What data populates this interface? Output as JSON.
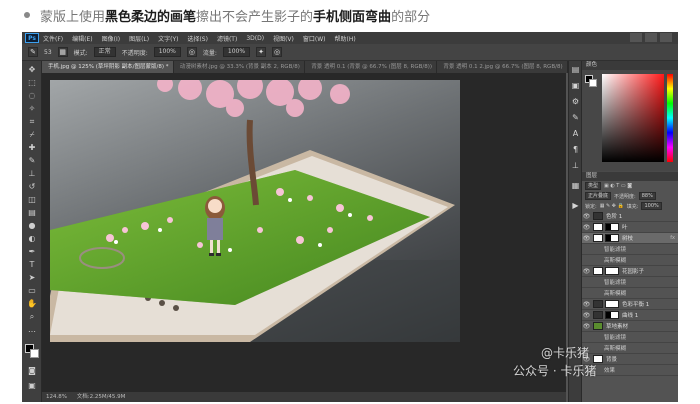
{
  "caption": {
    "part1": "蒙版上使用",
    "part2": "黑色柔边的画笔",
    "part3": "擦出不会产生影子的",
    "part4": "手机侧面弯曲",
    "part5": "的部分"
  },
  "menubar": {
    "logo": "Ps",
    "items": [
      "文件(F)",
      "编辑(E)",
      "图像(I)",
      "图层(L)",
      "文字(Y)",
      "选择(S)",
      "滤镜(T)",
      "3D(D)",
      "视图(V)",
      "窗口(W)",
      "帮助(H)"
    ]
  },
  "options": {
    "brush_size": "53",
    "mode_label": "模式:",
    "mode_value": "正常",
    "opacity_label": "不透明度:",
    "opacity_value": "100%",
    "flow_label": "流量:",
    "flow_value": "100%"
  },
  "tabs": [
    "手机.jpg @ 125% (草坪阴影 副本/图层蒙版/8) *",
    "动漫树素材.jpg @ 33.3% (背景 副本 2, RGB/8)",
    "背景 透明 0.1 (背景 @ 66.7% (图层 8, RGB/8))",
    "背景 透明 0.1 2.jpg @ 66.7% (图层 8, RGB/8)"
  ],
  "status": {
    "zoom": "124.8%",
    "doc": "文档:2.25M/45.9M"
  },
  "color_panel": {
    "title": "颜色",
    "fg": "#000000",
    "bg": "#ffffff"
  },
  "layers": {
    "title": "图层",
    "filter_label": "类型",
    "blend_mode": "正片叠底",
    "opacity_label": "不透明度:",
    "opacity_value": "88%",
    "lock_label": "锁定:",
    "fill_label": "填充:",
    "fill_value": "100%",
    "items": [
      {
        "name": "色阶 1",
        "type": "adjust"
      },
      {
        "name": "叶",
        "type": "layer"
      },
      {
        "name": "树枝",
        "type": "layer",
        "selected": true
      },
      {
        "name": "智能滤镜",
        "type": "sub"
      },
      {
        "name": "高斯模糊",
        "type": "sub"
      },
      {
        "name": "花园影子",
        "type": "layer"
      },
      {
        "name": "智能滤镜",
        "type": "sub"
      },
      {
        "name": "高斯模糊",
        "type": "sub"
      },
      {
        "name": "色彩平衡 1",
        "type": "adjust"
      },
      {
        "name": "曲线 1",
        "type": "adjust"
      },
      {
        "name": "草地素材",
        "type": "layer"
      },
      {
        "name": "智能滤镜",
        "type": "sub"
      },
      {
        "name": "高斯模糊",
        "type": "sub"
      },
      {
        "name": "背景",
        "type": "layer"
      },
      {
        "name": "效果",
        "type": "sub"
      }
    ]
  },
  "watermark": {
    "line1": "@卡乐猪",
    "line2": "公众号 · 卡乐猪"
  }
}
